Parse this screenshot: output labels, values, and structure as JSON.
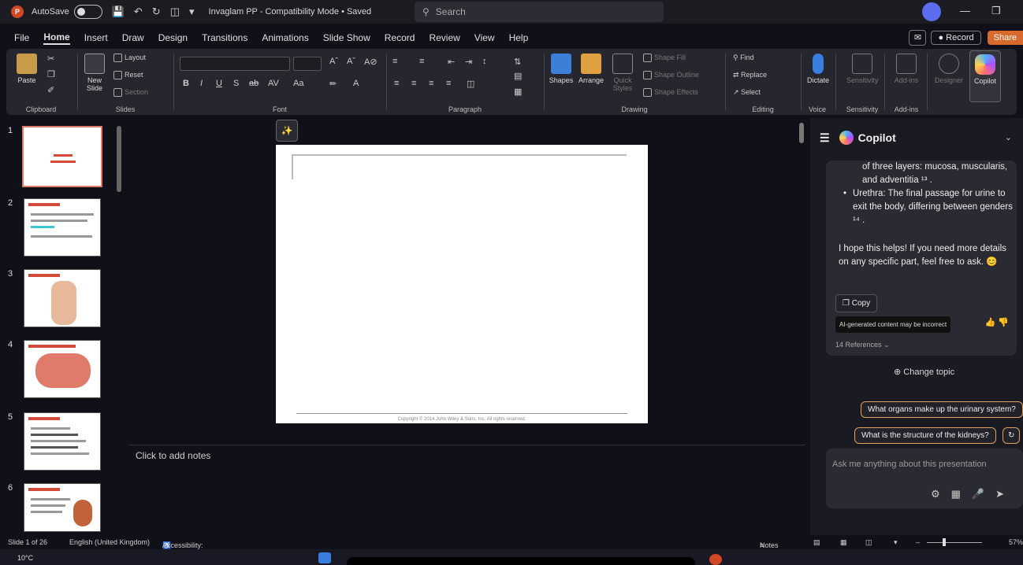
{
  "titlebar": {
    "autosave_label": "AutoSave",
    "document_title": "Invaglam PP  -  Compatibility Mode • Saved",
    "search_placeholder": "Search"
  },
  "menu": {
    "tabs": [
      "File",
      "Home",
      "Insert",
      "Draw",
      "Design",
      "Transitions",
      "Animations",
      "Slide Show",
      "Record",
      "Review",
      "View",
      "Help"
    ],
    "active_tab": "Home",
    "record_label": "Record",
    "share_label": "Share"
  },
  "ribbon": {
    "clipboard": {
      "paste": "Paste",
      "label": "Clipboard"
    },
    "slides": {
      "new_slide": "New Slide",
      "layout": "Layout",
      "reset": "Reset",
      "section": "Section",
      "label": "Slides"
    },
    "font": {
      "label": "Font"
    },
    "paragraph": {
      "label": "Paragraph"
    },
    "drawing": {
      "shapes": "Shapes",
      "arrange": "Arrange",
      "quick_styles": "Quick Styles",
      "shape_fill": "Shape Fill",
      "shape_outline": "Shape Outline",
      "shape_effects": "Shape Effects",
      "label": "Drawing"
    },
    "editing": {
      "find": "Find",
      "replace": "Replace",
      "select": "Select",
      "label": "Editing"
    },
    "voice": {
      "dictate": "Dictate",
      "label": "Voice"
    },
    "sensitivity": {
      "btn": "Sensitivity",
      "label": "Sensitivity"
    },
    "addins": {
      "btn": "Add-ins",
      "label": "Add-ins"
    },
    "designer": "Designer",
    "copilot": "Copilot"
  },
  "thumbnails": [
    "1",
    "2",
    "3",
    "4",
    "5",
    "6"
  ],
  "slide": {
    "copyright": "Copyright © 2014 John Wiley & Sons, Inc. All rights reserved."
  },
  "notes": {
    "placeholder": "Click to add notes"
  },
  "copilot": {
    "title": "Copilot",
    "line_cont": "of three layers: mucosa, muscularis, and adventitia ¹³ .",
    "bullet_urethra": "Urethra: The final passage for urine to exit the body, differing between genders ¹⁴ .",
    "closing": "I hope this helps! If you need more details on any specific part, feel free to ask. 😊",
    "copy_label": "Copy",
    "ai_disclaimer": "AI-generated content may be incorrect",
    "references": "14 References",
    "change_topic": "Change topic",
    "suggestion_1": "What organs make up the urinary system?",
    "suggestion_2": "What is the structure of the kidneys?",
    "input_placeholder": "Ask me anything about this presentation"
  },
  "status": {
    "slide_count": "Slide 1 of 26",
    "language": "English (United Kingdom)",
    "accessibility": "Accessibility: Unavailable",
    "notes": "Notes",
    "zoom": "57%"
  },
  "taskbar": {
    "temperature": "10°C"
  }
}
